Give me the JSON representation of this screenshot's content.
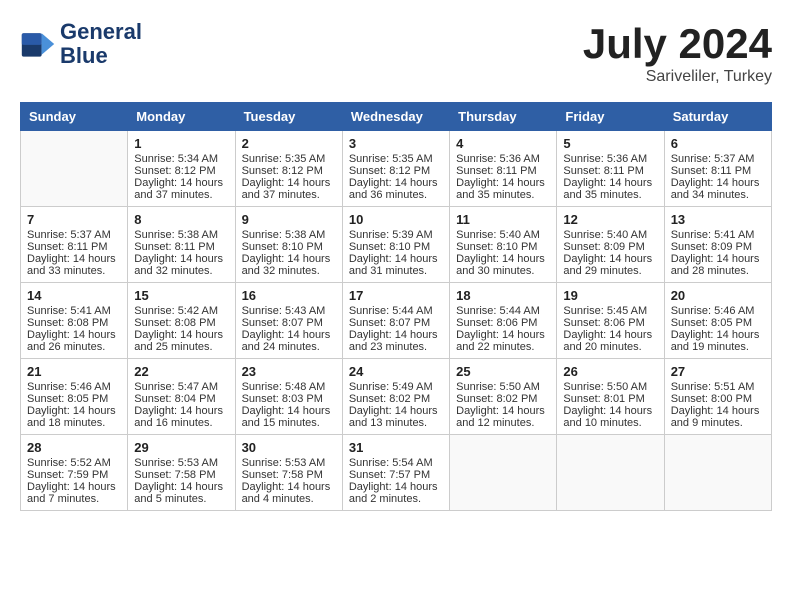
{
  "header": {
    "logo_line1": "General",
    "logo_line2": "Blue",
    "month": "July 2024",
    "location": "Sariveliler, Turkey"
  },
  "weekdays": [
    "Sunday",
    "Monday",
    "Tuesday",
    "Wednesday",
    "Thursday",
    "Friday",
    "Saturday"
  ],
  "weeks": [
    [
      {
        "day": "",
        "info": ""
      },
      {
        "day": "1",
        "info": "Sunrise: 5:34 AM\nSunset: 8:12 PM\nDaylight: 14 hours\nand 37 minutes."
      },
      {
        "day": "2",
        "info": "Sunrise: 5:35 AM\nSunset: 8:12 PM\nDaylight: 14 hours\nand 37 minutes."
      },
      {
        "day": "3",
        "info": "Sunrise: 5:35 AM\nSunset: 8:12 PM\nDaylight: 14 hours\nand 36 minutes."
      },
      {
        "day": "4",
        "info": "Sunrise: 5:36 AM\nSunset: 8:11 PM\nDaylight: 14 hours\nand 35 minutes."
      },
      {
        "day": "5",
        "info": "Sunrise: 5:36 AM\nSunset: 8:11 PM\nDaylight: 14 hours\nand 35 minutes."
      },
      {
        "day": "6",
        "info": "Sunrise: 5:37 AM\nSunset: 8:11 PM\nDaylight: 14 hours\nand 34 minutes."
      }
    ],
    [
      {
        "day": "7",
        "info": "Sunrise: 5:37 AM\nSunset: 8:11 PM\nDaylight: 14 hours\nand 33 minutes."
      },
      {
        "day": "8",
        "info": "Sunrise: 5:38 AM\nSunset: 8:11 PM\nDaylight: 14 hours\nand 32 minutes."
      },
      {
        "day": "9",
        "info": "Sunrise: 5:38 AM\nSunset: 8:10 PM\nDaylight: 14 hours\nand 32 minutes."
      },
      {
        "day": "10",
        "info": "Sunrise: 5:39 AM\nSunset: 8:10 PM\nDaylight: 14 hours\nand 31 minutes."
      },
      {
        "day": "11",
        "info": "Sunrise: 5:40 AM\nSunset: 8:10 PM\nDaylight: 14 hours\nand 30 minutes."
      },
      {
        "day": "12",
        "info": "Sunrise: 5:40 AM\nSunset: 8:09 PM\nDaylight: 14 hours\nand 29 minutes."
      },
      {
        "day": "13",
        "info": "Sunrise: 5:41 AM\nSunset: 8:09 PM\nDaylight: 14 hours\nand 28 minutes."
      }
    ],
    [
      {
        "day": "14",
        "info": "Sunrise: 5:41 AM\nSunset: 8:08 PM\nDaylight: 14 hours\nand 26 minutes."
      },
      {
        "day": "15",
        "info": "Sunrise: 5:42 AM\nSunset: 8:08 PM\nDaylight: 14 hours\nand 25 minutes."
      },
      {
        "day": "16",
        "info": "Sunrise: 5:43 AM\nSunset: 8:07 PM\nDaylight: 14 hours\nand 24 minutes."
      },
      {
        "day": "17",
        "info": "Sunrise: 5:44 AM\nSunset: 8:07 PM\nDaylight: 14 hours\nand 23 minutes."
      },
      {
        "day": "18",
        "info": "Sunrise: 5:44 AM\nSunset: 8:06 PM\nDaylight: 14 hours\nand 22 minutes."
      },
      {
        "day": "19",
        "info": "Sunrise: 5:45 AM\nSunset: 8:06 PM\nDaylight: 14 hours\nand 20 minutes."
      },
      {
        "day": "20",
        "info": "Sunrise: 5:46 AM\nSunset: 8:05 PM\nDaylight: 14 hours\nand 19 minutes."
      }
    ],
    [
      {
        "day": "21",
        "info": "Sunrise: 5:46 AM\nSunset: 8:05 PM\nDaylight: 14 hours\nand 18 minutes."
      },
      {
        "day": "22",
        "info": "Sunrise: 5:47 AM\nSunset: 8:04 PM\nDaylight: 14 hours\nand 16 minutes."
      },
      {
        "day": "23",
        "info": "Sunrise: 5:48 AM\nSunset: 8:03 PM\nDaylight: 14 hours\nand 15 minutes."
      },
      {
        "day": "24",
        "info": "Sunrise: 5:49 AM\nSunset: 8:02 PM\nDaylight: 14 hours\nand 13 minutes."
      },
      {
        "day": "25",
        "info": "Sunrise: 5:50 AM\nSunset: 8:02 PM\nDaylight: 14 hours\nand 12 minutes."
      },
      {
        "day": "26",
        "info": "Sunrise: 5:50 AM\nSunset: 8:01 PM\nDaylight: 14 hours\nand 10 minutes."
      },
      {
        "day": "27",
        "info": "Sunrise: 5:51 AM\nSunset: 8:00 PM\nDaylight: 14 hours\nand 9 minutes."
      }
    ],
    [
      {
        "day": "28",
        "info": "Sunrise: 5:52 AM\nSunset: 7:59 PM\nDaylight: 14 hours\nand 7 minutes."
      },
      {
        "day": "29",
        "info": "Sunrise: 5:53 AM\nSunset: 7:58 PM\nDaylight: 14 hours\nand 5 minutes."
      },
      {
        "day": "30",
        "info": "Sunrise: 5:53 AM\nSunset: 7:58 PM\nDaylight: 14 hours\nand 4 minutes."
      },
      {
        "day": "31",
        "info": "Sunrise: 5:54 AM\nSunset: 7:57 PM\nDaylight: 14 hours\nand 2 minutes."
      },
      {
        "day": "",
        "info": ""
      },
      {
        "day": "",
        "info": ""
      },
      {
        "day": "",
        "info": ""
      }
    ]
  ]
}
